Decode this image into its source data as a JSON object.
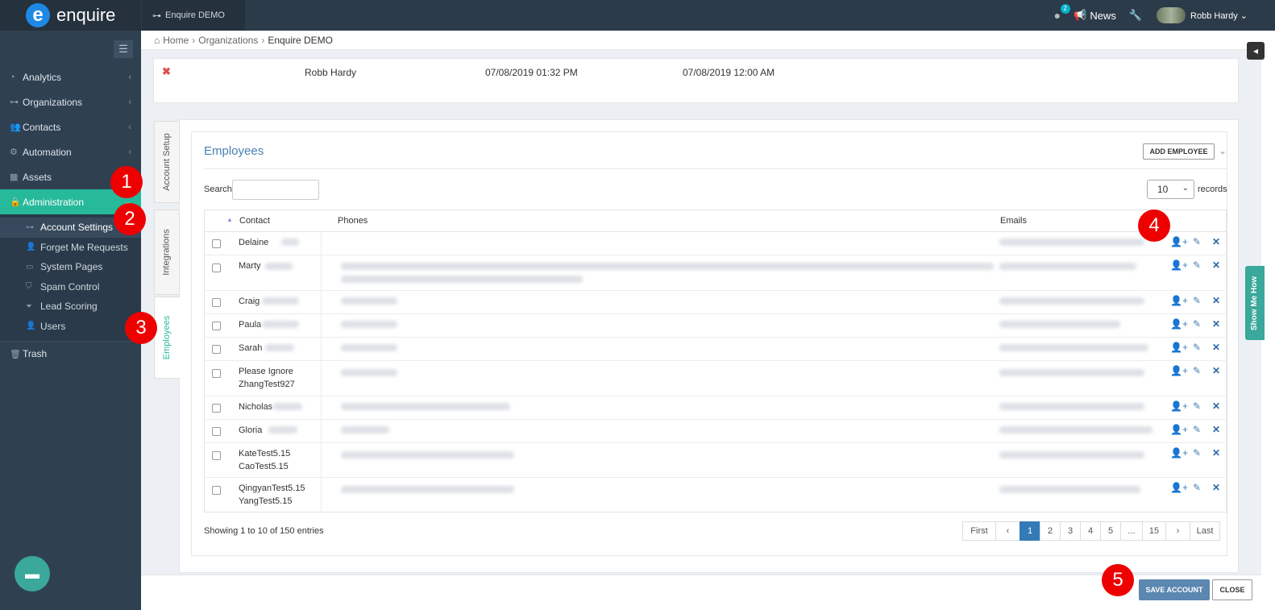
{
  "app": {
    "logo_text": "enquire",
    "org_tab": "Enquire DEMO",
    "notif_count": "2",
    "news_label": "News",
    "user_name": "Robb Hardy"
  },
  "sidebar": {
    "items": [
      {
        "label": "Analytics",
        "icon": "chart-icon"
      },
      {
        "label": "Organizations",
        "icon": "sitemap-icon"
      },
      {
        "label": "Contacts",
        "icon": "users-icon"
      },
      {
        "label": "Automation",
        "icon": "cogs-icon"
      },
      {
        "label": "Assets",
        "icon": "grid-icon"
      },
      {
        "label": "Administration",
        "icon": "lock-icon",
        "active": true
      }
    ],
    "subitems": [
      {
        "label": "Account Settings",
        "selected": true
      },
      {
        "label": "Forget Me Requests"
      },
      {
        "label": "System Pages"
      },
      {
        "label": "Spam Control"
      },
      {
        "label": "Lead Scoring"
      },
      {
        "label": "Users"
      }
    ],
    "trash": "Trash"
  },
  "breadcrumb": {
    "home": "Home",
    "organizations": "Organizations",
    "current": "Enquire DEMO"
  },
  "summary_row": {
    "name": "Robb Hardy",
    "date1": "07/08/2019 01:32 PM",
    "date2": "07/08/2019 12:00 AM"
  },
  "vtabs": [
    "Account Setup",
    "Integrations",
    "Employees"
  ],
  "employees": {
    "title": "Employees",
    "add_button": "ADD EMPLOYEE",
    "search_label": "Search:",
    "records_value": "10",
    "records_label": "records",
    "columns": [
      "Contact",
      "Phones",
      "Emails"
    ],
    "rows": [
      {
        "contact": "Delaine"
      },
      {
        "contact": "Marty"
      },
      {
        "contact": "Craig"
      },
      {
        "contact": "Paula"
      },
      {
        "contact": "Sarah"
      },
      {
        "contact": "Please Ignore ZhangTest927"
      },
      {
        "contact": "Nicholas"
      },
      {
        "contact": "Gloria"
      },
      {
        "contact": "KateTest5.15 CaoTest5.15"
      },
      {
        "contact": "QingyanTest5.15 YangTest5.15"
      }
    ],
    "showing": "Showing 1 to 10 of 150 entries",
    "pager": [
      "First",
      "‹",
      "1",
      "2",
      "3",
      "4",
      "5",
      "...",
      "15",
      "›",
      "Last"
    ]
  },
  "footer": {
    "save": "SAVE ACCOUNT",
    "close": "CLOSE"
  },
  "show_me_how": "Show Me How",
  "markers": [
    "1",
    "2",
    "3",
    "4",
    "5"
  ],
  "colors": {
    "accent": "#26b99a",
    "link": "#4a7fb5",
    "marker": "#e00000",
    "topbar": "#2c3b4a",
    "sidebar": "#2f4051"
  }
}
